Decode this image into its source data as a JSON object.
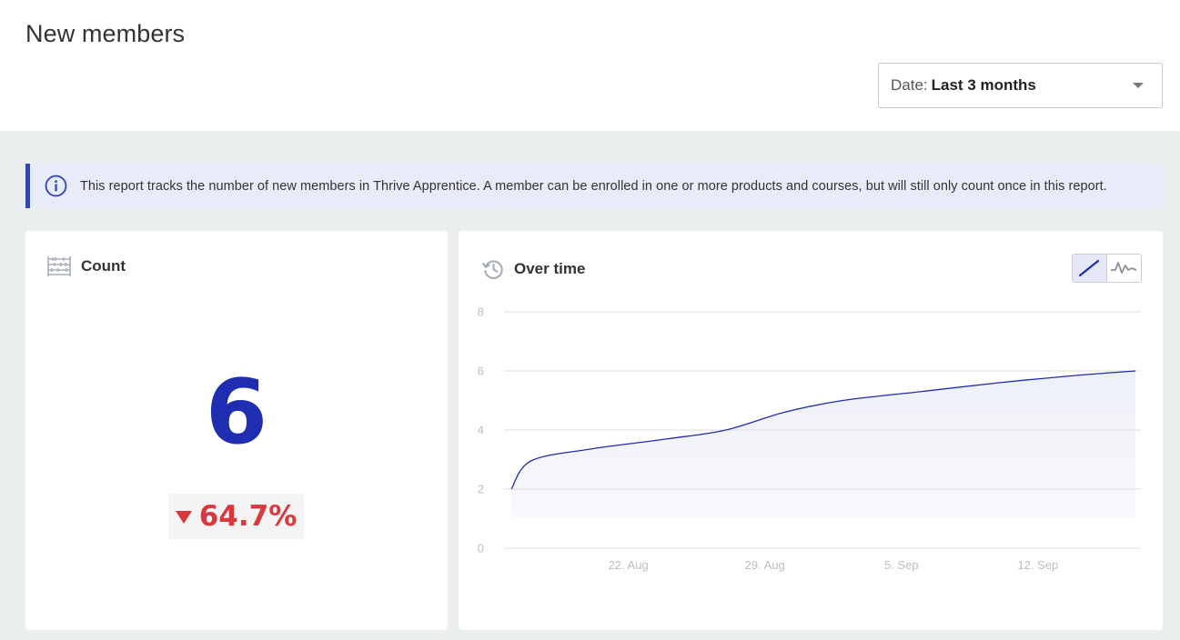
{
  "header": {
    "title": "New members",
    "date_filter": {
      "label": "Date:",
      "value": "Last 3 months"
    }
  },
  "info_banner": {
    "text": "This report tracks the number of new members in Thrive Apprentice. A member can be enrolled in one or more products and courses, but will still only count once in this report."
  },
  "count_card": {
    "title": "Count",
    "value": "6",
    "change": "64.7%",
    "change_direction": "down",
    "change_color": "#d9383d",
    "value_color": "#1f2db0"
  },
  "over_time_card": {
    "title": "Over time",
    "toggle": {
      "options": [
        "line-chart-icon",
        "sparkline-chart-icon"
      ],
      "selected": "line-chart-icon"
    }
  },
  "chart_data": {
    "type": "area",
    "x_tick_labels": [
      "22. Aug",
      "29. Aug",
      "5. Sep",
      "12. Sep"
    ],
    "y_tick_labels": [
      "0",
      "2",
      "4",
      "6",
      "8"
    ],
    "ylim": [
      0,
      8
    ],
    "grid": true,
    "series": [
      {
        "color": "#1f2db0",
        "x": [
          "2024-08-16",
          "2024-08-17",
          "2024-08-20",
          "2024-08-24",
          "2024-08-27",
          "2024-08-30",
          "2024-09-02",
          "2024-09-06",
          "2024-09-10",
          "2024-09-14",
          "2024-09-17"
        ],
        "values": [
          2.0,
          2.95,
          3.35,
          3.7,
          4.0,
          4.6,
          5.0,
          5.3,
          5.6,
          5.85,
          6.0
        ]
      }
    ],
    "x_ticks_dates": [
      "2024-08-22",
      "2024-08-29",
      "2024-09-05",
      "2024-09-12"
    ]
  }
}
